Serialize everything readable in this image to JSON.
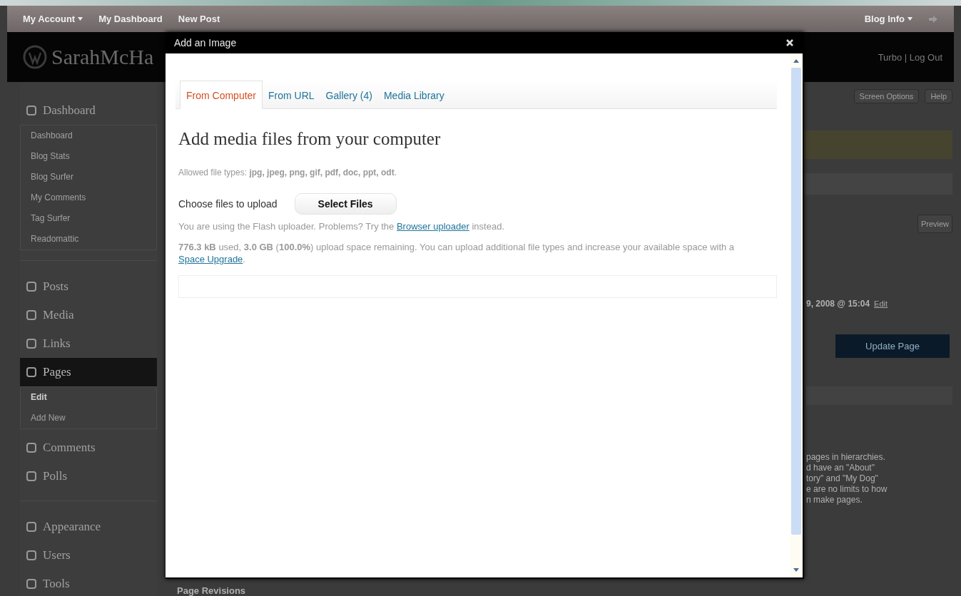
{
  "admin_bar": {
    "left_items": [
      {
        "label": "My Account",
        "dropdown": true
      },
      {
        "label": "My Dashboard",
        "dropdown": false
      },
      {
        "label": "New Post",
        "dropdown": false
      }
    ],
    "right_items": [
      {
        "label": "Blog Info",
        "dropdown": true
      }
    ]
  },
  "header": {
    "site_title": "SarahMcHa",
    "links": "Turbo | Log Out"
  },
  "sidebar": {
    "groups": [
      [
        {
          "label": "Dashboard",
          "selected": false,
          "children": [
            {
              "label": "Dashboard",
              "selected": false
            },
            {
              "label": "Blog Stats",
              "selected": false
            },
            {
              "label": "Blog Surfer",
              "selected": false
            },
            {
              "label": "My Comments",
              "selected": false
            },
            {
              "label": "Tag Surfer",
              "selected": false
            },
            {
              "label": "Readomattic",
              "selected": false
            }
          ]
        }
      ],
      [
        {
          "label": "Posts",
          "selected": false
        },
        {
          "label": "Media",
          "selected": false
        },
        {
          "label": "Links",
          "selected": false
        },
        {
          "label": "Pages",
          "selected": true,
          "children": [
            {
              "label": "Edit",
              "selected": true
            },
            {
              "label": "Add New",
              "selected": false
            }
          ]
        },
        {
          "label": "Comments",
          "selected": false
        },
        {
          "label": "Polls",
          "selected": false
        }
      ],
      [
        {
          "label": "Appearance",
          "selected": false
        },
        {
          "label": "Users",
          "selected": false
        },
        {
          "label": "Tools",
          "selected": false
        }
      ]
    ]
  },
  "page": {
    "screen_options": "Screen Options",
    "help": "Help",
    "preview": "Preview",
    "timestamp": "9, 2008 @ 15:04",
    "timestamp_edit": "Edit",
    "update_button": "Update Page",
    "help_lines": [
      "pages in hierarchies.",
      "d have an \"About\"",
      "tory\" and \"My Dog\"",
      "e are no limits to how",
      "n make pages."
    ],
    "page_revisions": "Page Revisions"
  },
  "dialog": {
    "title": "Add an Image",
    "tabs": [
      {
        "label": "From Computer",
        "selected": true
      },
      {
        "label": "From URL",
        "selected": false
      },
      {
        "label": "Gallery (4)",
        "selected": false
      },
      {
        "label": "Media Library",
        "selected": false
      }
    ],
    "heading": "Add media files from your computer",
    "allowed_types": "Allowed file types: **jpg, jpeg, png, gif, pdf, doc, ppt, odt**.",
    "choose_label": "Choose files to upload",
    "select_button": "Select Files",
    "flash_note": {
      "before": "You are using the Flash uploader. Problems? Try the",
      "link": "Browser uploader",
      "after": "instead."
    },
    "space_note": {
      "before": "**776.3 kB** used, **3.0 GB** (**100.0%**) upload space remaining. You can upload additional file types and increase your available space with a",
      "link": "Space Upgrade",
      "after": "."
    }
  }
}
